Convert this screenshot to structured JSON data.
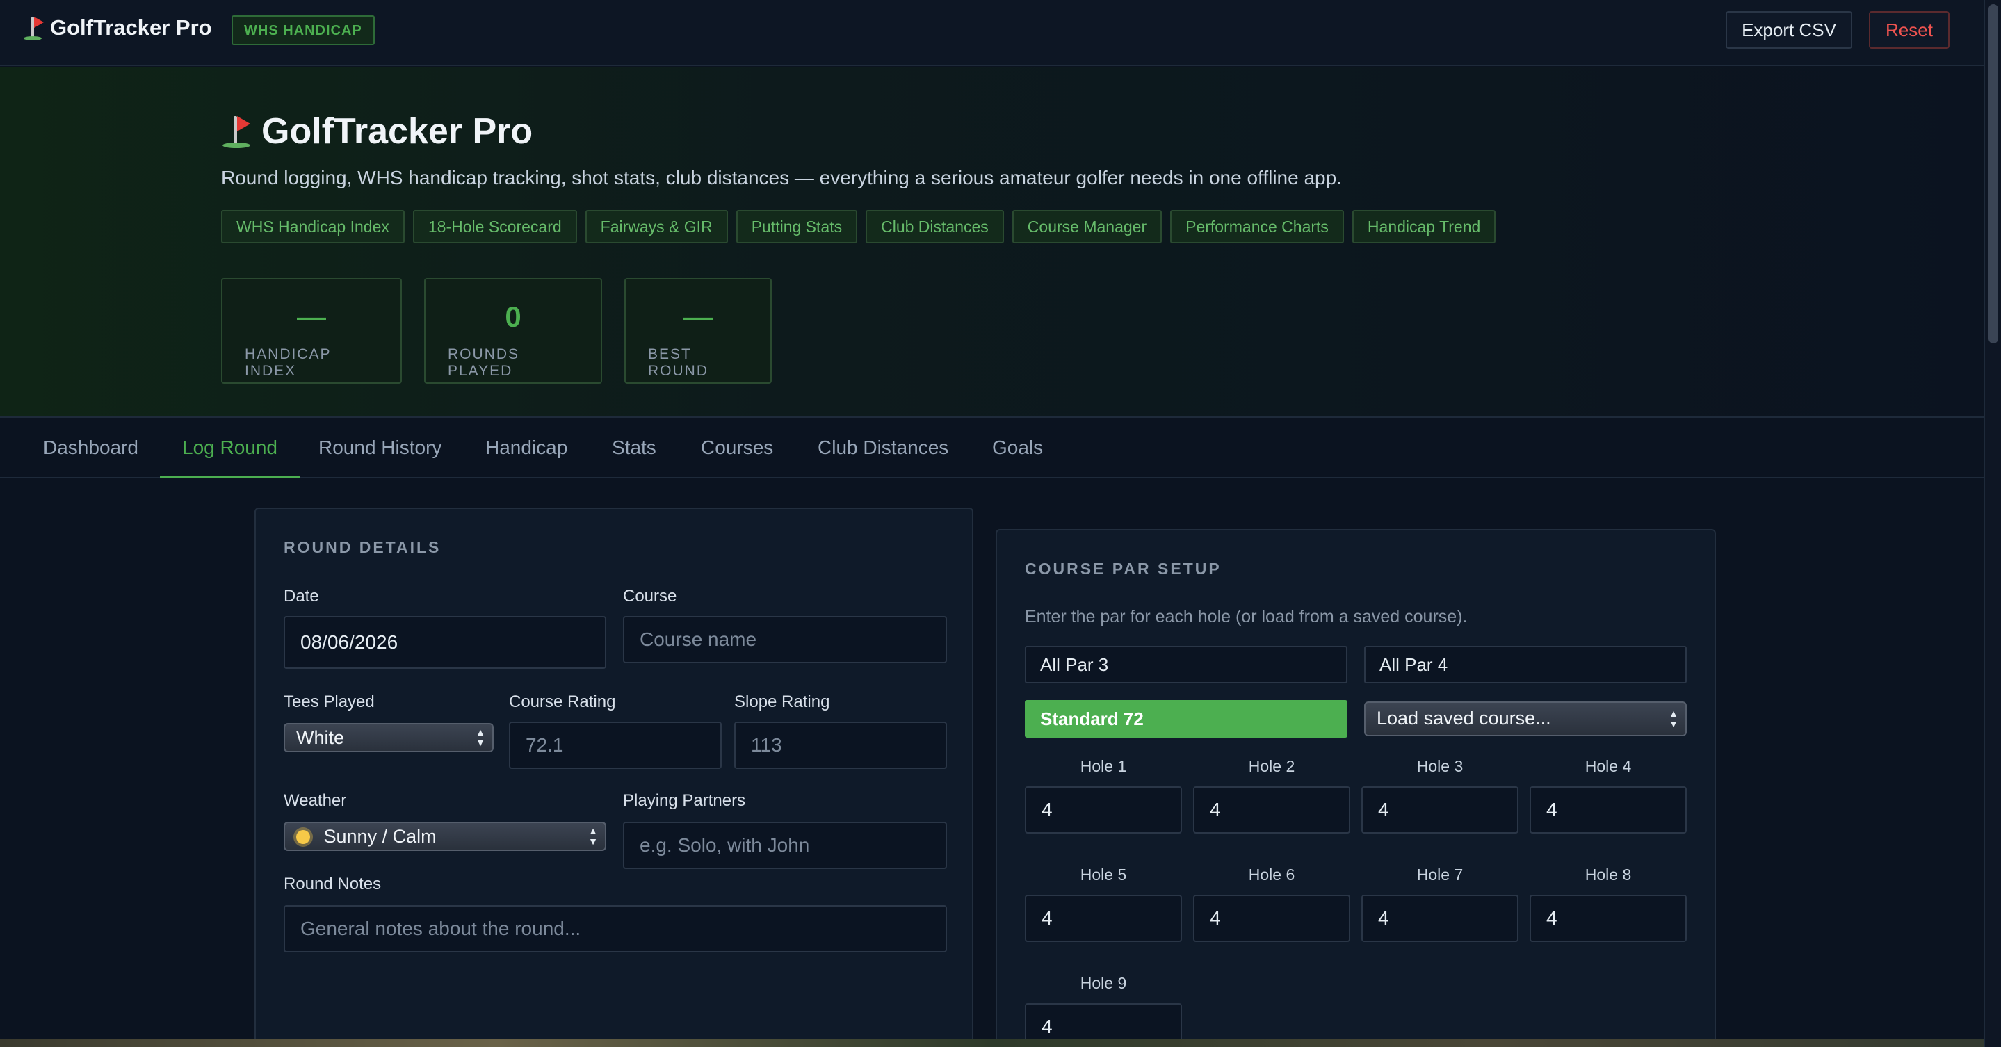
{
  "app": {
    "brand": "GolfTracker Pro",
    "badge": "WHS HANDICAP",
    "export_label": "Export CSV",
    "reset_label": "Reset"
  },
  "hero": {
    "title": "GolfTracker Pro",
    "subtitle": "Round logging, WHS handicap tracking, shot stats, club distances — everything a serious amateur golfer needs in one offline app.",
    "chips": [
      "WHS Handicap Index",
      "18-Hole Scorecard",
      "Fairways & GIR",
      "Putting Stats",
      "Club Distances",
      "Course Manager",
      "Performance Charts",
      "Handicap Trend"
    ],
    "stats": [
      {
        "value": "—",
        "label": "HANDICAP INDEX"
      },
      {
        "value": "0",
        "label": "ROUNDS PLAYED"
      },
      {
        "value": "—",
        "label": "BEST ROUND"
      }
    ]
  },
  "tabs": [
    "Dashboard",
    "Log Round",
    "Round History",
    "Handicap",
    "Stats",
    "Courses",
    "Club Distances",
    "Goals"
  ],
  "active_tab": "Log Round",
  "round_details": {
    "title": "ROUND DETAILS",
    "date_label": "Date",
    "date_value": "08/06/2026",
    "course_label": "Course",
    "course_placeholder": "Course name",
    "tees_label": "Tees Played",
    "tees_value": "White",
    "rating_label": "Course Rating",
    "rating_placeholder": "72.1",
    "slope_label": "Slope Rating",
    "slope_placeholder": "113",
    "weather_label": "Weather",
    "weather_value": "Sunny / Calm",
    "weather_icon": "sun-icon",
    "partners_label": "Playing Partners",
    "partners_placeholder": "e.g. Solo, with John",
    "notes_label": "Round Notes",
    "notes_placeholder": "General notes about the round..."
  },
  "par_setup": {
    "title": "COURSE PAR SETUP",
    "help": "Enter the par for each hole (or load from a saved course).",
    "all_par3": "All Par 3",
    "all_par4": "All Par 4",
    "standard72": "Standard 72",
    "load_saved": "Load saved course...",
    "holes": [
      {
        "label": "Hole 1",
        "par": "4"
      },
      {
        "label": "Hole 2",
        "par": "4"
      },
      {
        "label": "Hole 3",
        "par": "4"
      },
      {
        "label": "Hole 4",
        "par": "4"
      },
      {
        "label": "Hole 5",
        "par": "4"
      },
      {
        "label": "Hole 6",
        "par": "4"
      },
      {
        "label": "Hole 7",
        "par": "4"
      },
      {
        "label": "Hole 8",
        "par": "4"
      },
      {
        "label": "Hole 9",
        "par": "4"
      }
    ]
  },
  "colors": {
    "accent": "#4caf50",
    "danger": "#ef5350",
    "background": "#0b1320"
  }
}
